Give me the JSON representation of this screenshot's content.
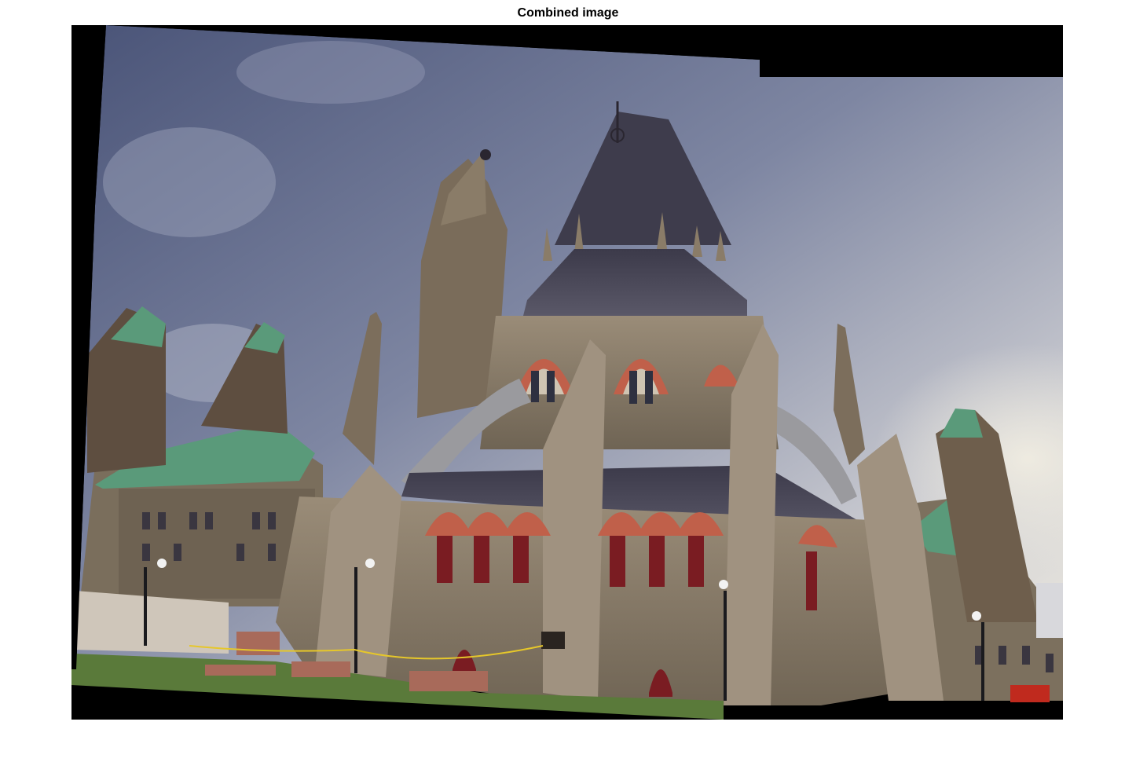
{
  "figure": {
    "title": "Combined image",
    "background": "#ffffff"
  },
  "image": {
    "subject": "panorama-stitched-gothic-library-building",
    "canvas_color": "#000000",
    "sky_colors": [
      "#4a5478",
      "#7e86a2",
      "#c9cad0",
      "#eeeae0"
    ],
    "stone_color": "#8a7c6a",
    "roof_color": "#4a4858",
    "copper_roof_color": "#5a9a7a",
    "brick_arch_color": "#c0604a",
    "window_color": "#7a1c22",
    "grass_color": "#5a7a3a"
  }
}
